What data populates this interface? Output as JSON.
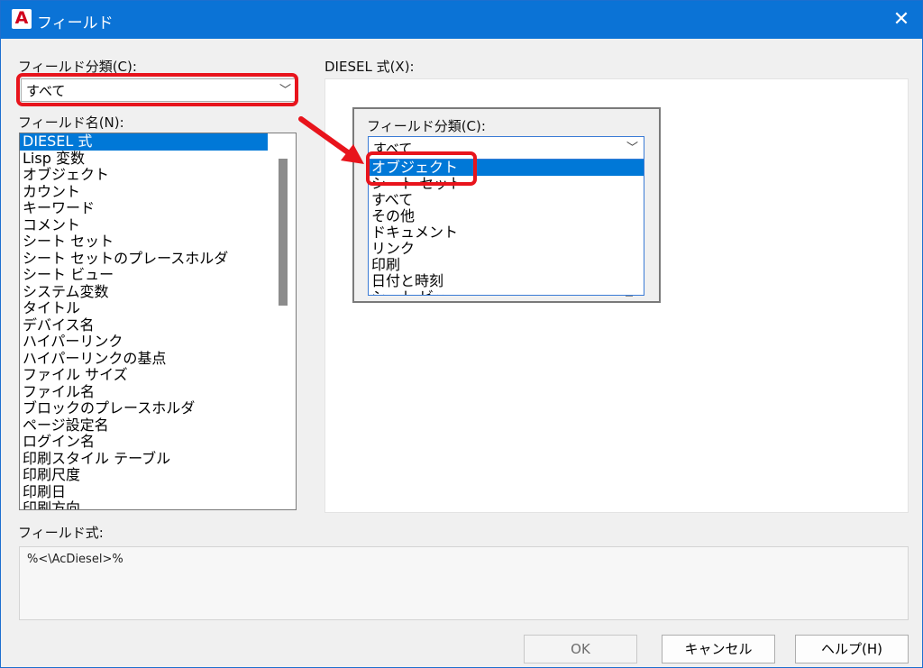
{
  "window": {
    "app_icon_letter": "A",
    "title": "フィールド",
    "close_glyph": "✕"
  },
  "left": {
    "category_label": "フィールド分類(C):",
    "category_value": "すべて",
    "field_name_label": "フィールド名(N):",
    "field_names": [
      "DIESEL 式",
      "Lisp 変数",
      "オブジェクト",
      "カウント",
      "キーワード",
      "コメント",
      "シート セット",
      "シート セットのプレースホルダ",
      "シート ビュー",
      "システム変数",
      "タイトル",
      "デバイス名",
      "ハイパーリンク",
      "ハイパーリンクの基点",
      "ファイル サイズ",
      "ファイル名",
      "ブロックのプレースホルダ",
      "ページ設定名",
      "ログイン名",
      "印刷スタイル テーブル",
      "印刷尺度",
      "印刷日",
      "印刷方向"
    ],
    "selected_index": 0
  },
  "right": {
    "diesel_label": "DIESEL 式(X):",
    "inset_category_label": "フィールド分類(C):",
    "inset_category_value": "すべて",
    "dropdown_options": [
      "オブジェクト",
      "シート セット",
      "すべて",
      "その他",
      "ドキュメント",
      "リンク",
      "印刷",
      "日付と時刻",
      "シート ビュー"
    ],
    "dropdown_selected_index": 0
  },
  "expression": {
    "label": "フィールド式:",
    "value": "%<\\AcDiesel>%"
  },
  "buttons": {
    "ok": "OK",
    "cancel": "キャンセル",
    "help": "ヘルプ(H)"
  },
  "colors": {
    "titlebar": "#0b73d6",
    "selection": "#0078d7",
    "annotation_red": "#e8141c"
  }
}
